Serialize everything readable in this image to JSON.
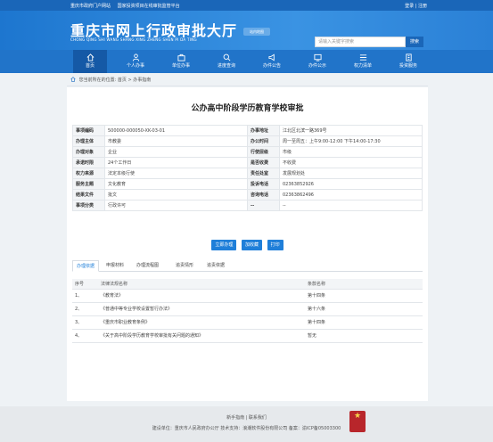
{
  "topbar": {
    "links": [
      "重庆市政府门户网站",
      "国家投资项目在线审批监管平台"
    ],
    "login": "登录",
    "register": "注册"
  },
  "header": {
    "title": "重庆市网上行政审批大厅",
    "pinyin": "CHONG QING SHI WANG SHANG XING ZHENG SHEN PI DA TING",
    "location_button": "站内地图",
    "search_placeholder": "请输入关键字搜索",
    "search_button": "搜索"
  },
  "nav": {
    "items": [
      {
        "label": "首页",
        "icon": "home-icon"
      },
      {
        "label": "个人办事",
        "icon": "person-icon"
      },
      {
        "label": "单位办事",
        "icon": "briefcase-icon"
      },
      {
        "label": "进度查询",
        "icon": "search-icon"
      },
      {
        "label": "办件公告",
        "icon": "announcement-icon"
      },
      {
        "label": "办件公示",
        "icon": "publicity-icon"
      },
      {
        "label": "权力清单",
        "icon": "list-icon"
      },
      {
        "label": "投资服务",
        "icon": "building-icon"
      }
    ]
  },
  "breadcrumb": {
    "prefix": "您当前所在的位置:",
    "home": "首页",
    "sep": ">",
    "current": "办事指南"
  },
  "guide": {
    "title": "公办高中阶段学历教育学校审批",
    "rows": [
      [
        "事项编码",
        "500000-000050-XK-03-01",
        "办事地址",
        "江北区北滨一路369号"
      ],
      [
        "办理主体",
        "市教委",
        "办公时间",
        "周一至周五：上午9:00-12:00 下午14:00-17:30"
      ],
      [
        "办理对象",
        "企业",
        "行使层级",
        "市级"
      ],
      [
        "承诺时限",
        "24个工作日",
        "是否收费",
        "不收费"
      ],
      [
        "权力来源",
        "法定本级行使",
        "责任处室",
        "发展规划处"
      ],
      [
        "服务主题",
        "文化教育",
        "投诉电话",
        "02363852926"
      ],
      [
        "结果文件",
        "批文",
        "咨询电话",
        "02363862496"
      ],
      [
        "事项分类",
        "行政许可",
        "--",
        "--"
      ]
    ]
  },
  "actions": [
    "立即办理",
    "加收藏",
    "打印"
  ],
  "tabs": [
    "办理依据",
    "申报材料",
    "办理流程图",
    "追责情形",
    "追责依据"
  ],
  "laws": {
    "headers": [
      "序号",
      "法律法规名称",
      "条款名称"
    ],
    "rows": [
      [
        "1、",
        "《教育法》",
        "第十四条"
      ],
      [
        "2、",
        "《普通中等专业学校设置暂行办法》",
        "第十六条"
      ],
      [
        "3、",
        "《重庆市职业教育条例》",
        "第十四条"
      ],
      [
        "4、",
        "《关于高中阶段学历教育学校审批有关问题的通知》",
        "暂无"
      ]
    ]
  },
  "footer": {
    "links": "新手指南 | 联系我们",
    "info": "建设单位：重庆市人民政府办公厅    技术支持：浪潮软件股份有限公司    备案：渝ICP备05003300"
  }
}
